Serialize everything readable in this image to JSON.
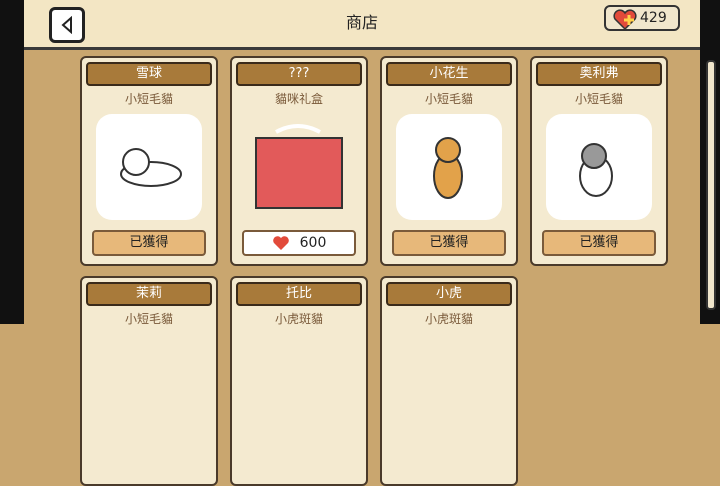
{
  "header": {
    "title": "商店",
    "hearts": "429"
  },
  "shop": {
    "items": [
      {
        "name": "雪球",
        "type": "小短毛貓",
        "status": "已獲得"
      },
      {
        "name": "???",
        "type": "貓咪礼盒",
        "price": "600"
      },
      {
        "name": "小花生",
        "type": "小短毛貓",
        "status": "已獲得"
      },
      {
        "name": "奥利弗",
        "type": "小短毛貓",
        "status": "已獲得"
      },
      {
        "name": "茉莉",
        "type": "小短毛貓"
      },
      {
        "name": "托比",
        "type": "小虎斑貓"
      },
      {
        "name": "小虎",
        "type": "小虎斑貓"
      }
    ]
  },
  "colors": {
    "panel": "#f4ead0",
    "header": "#a87a3a",
    "button": "#e7b87a",
    "background": "#c9a66f"
  }
}
